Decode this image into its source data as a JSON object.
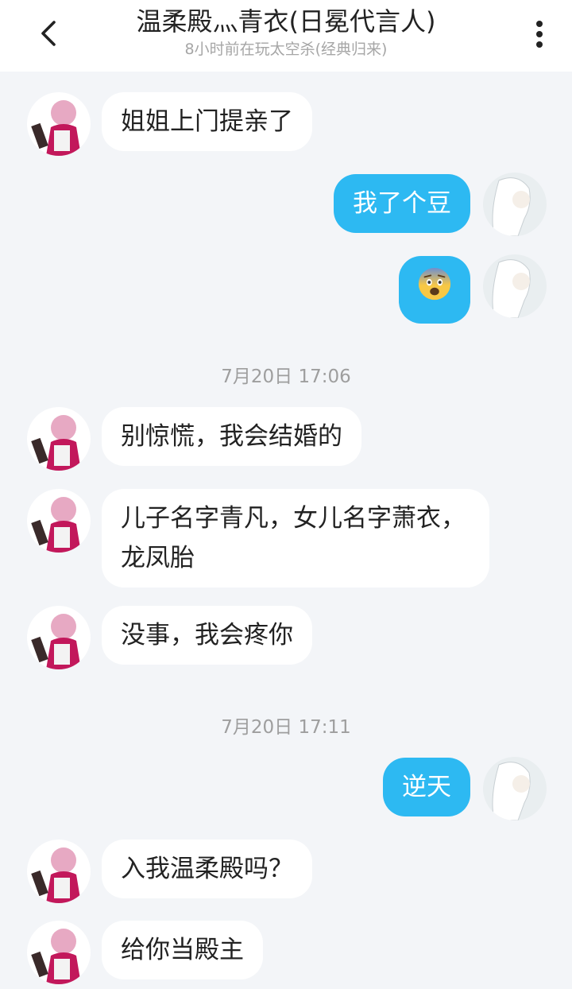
{
  "header": {
    "title": "温柔殿灬青衣(日冕代言人)",
    "subtitle": "8小时前在玩太空杀(经典归来)"
  },
  "colors": {
    "accent": "#2db9f2",
    "background": "#f3f5f8"
  },
  "icons": {
    "back": "chevron-left-icon",
    "more": "more-vertical-icon",
    "emoji": "anxious-face-emoji"
  },
  "messages": [
    {
      "side": "left",
      "text": "姐姐上门提亲了"
    },
    {
      "side": "right",
      "text": "我了个豆"
    },
    {
      "side": "right",
      "text": "😨"
    },
    {
      "type": "time",
      "text": "7月20日 17:06"
    },
    {
      "side": "left",
      "text": "别惊慌，我会结婚的"
    },
    {
      "side": "left",
      "text": "儿子名字青凡，女儿名字萧衣，龙凤胎"
    },
    {
      "side": "left",
      "text": "没事，我会疼你"
    },
    {
      "type": "time",
      "text": "7月20日 17:11"
    },
    {
      "side": "right",
      "text": "逆天"
    },
    {
      "side": "left",
      "text": "入我温柔殿吗？"
    },
    {
      "side": "left",
      "text": "给你当殿主"
    }
  ]
}
